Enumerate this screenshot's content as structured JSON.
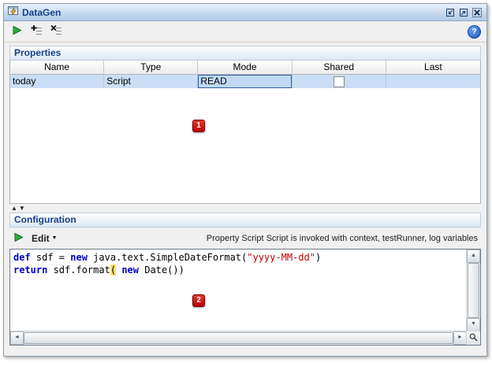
{
  "window": {
    "title": "DataGen"
  },
  "icons": {
    "help": "?",
    "collapse_up": "▲",
    "collapse_down": "▼",
    "edit_caret": "▼",
    "scroll_up": "▲",
    "scroll_down": "▼",
    "scroll_left": "◄",
    "scroll_right": "►"
  },
  "properties_section": {
    "title": "Properties",
    "columns": [
      "Name",
      "Type",
      "Mode",
      "Shared",
      "Last"
    ],
    "row": {
      "name": "today",
      "type": "Script",
      "mode": "READ",
      "shared_checked": false,
      "last": ""
    },
    "annotation": "1"
  },
  "configuration_section": {
    "title": "Configuration",
    "edit_button": "Edit",
    "info_text": "Property Script Script is invoked with context, testRunner, log variables",
    "annotation": "2",
    "code_lines": [
      {
        "tokens": [
          {
            "text": "def",
            "style": "keyword"
          },
          {
            "text": " sdf = ",
            "style": "plain"
          },
          {
            "text": "new",
            "style": "keyword"
          },
          {
            "text": " java.text.SimpleDateFormat(",
            "style": "plain"
          },
          {
            "text": "\"yyyy-MM-dd\"",
            "style": "string"
          },
          {
            "text": ")",
            "style": "plain"
          }
        ]
      },
      {
        "tokens": [
          {
            "text": "return",
            "style": "keyword"
          },
          {
            "text": " sdf.format",
            "style": "plain"
          },
          {
            "text": "(",
            "style": "bracket"
          },
          {
            "text": " ",
            "style": "plain"
          },
          {
            "text": "new",
            "style": "keyword"
          },
          {
            "text": " Date())",
            "style": "plain"
          }
        ]
      }
    ]
  },
  "colors": {
    "selection_blue": "#cadef5",
    "keyword_blue": "#0000cc",
    "string_red": "#c00000",
    "badge_red": "#c70000",
    "header_navy": "#15428b",
    "run_green": "#2fae3f"
  }
}
